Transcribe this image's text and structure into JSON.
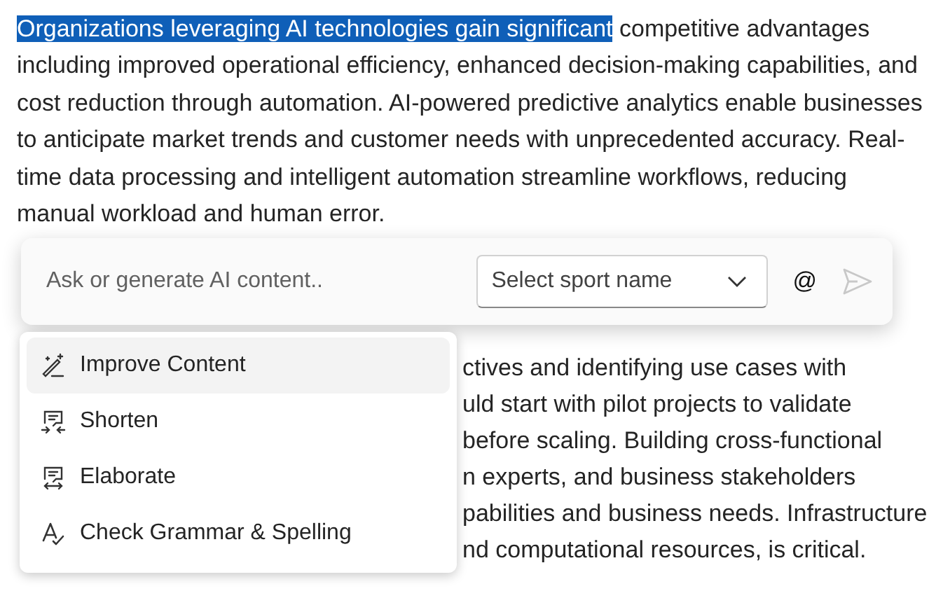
{
  "paragraph": {
    "highlighted": "Organizations leveraging AI technologies gain significant",
    "text": " competitive advantages including improved operational efficiency, enhanced decision-making capabilities, and cost reduction through automation. AI-powered predictive analytics enable businesses to anticipate market trends and customer needs with unprecedented accuracy. Real-time data processing and intelligent automation streamline workflows, reducing manual workload and human error."
  },
  "partly_hidden_lines": [
    "ctives and identifying use cases with",
    "uld start with pilot projects to validate",
    "before scaling. Building cross-functional",
    "n experts, and business stakeholders",
    "pabilities and business needs. Infrastructure",
    "nd computational resources, is critical."
  ],
  "prompt": {
    "placeholder": "Ask or generate AI content..",
    "dropdown": {
      "placeholder": "Select sport name"
    },
    "mention": "@",
    "send_disabled": true
  },
  "menu": [
    {
      "kind": "improve",
      "label": "Improve Content",
      "selected": true
    },
    {
      "kind": "shorten",
      "label": "Shorten",
      "selected": false
    },
    {
      "kind": "elaborate",
      "label": "Elaborate",
      "selected": false
    },
    {
      "kind": "grammar",
      "label": "Check Grammar & Spelling",
      "selected": false
    }
  ]
}
